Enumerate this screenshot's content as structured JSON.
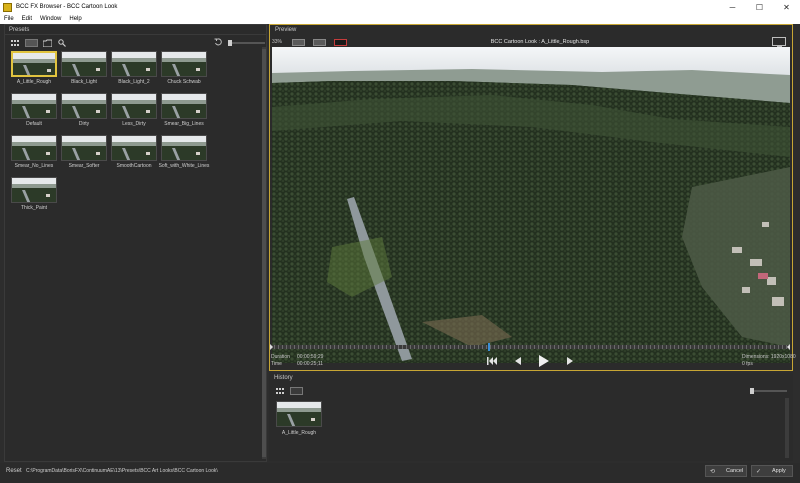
{
  "window": {
    "title": "BCC FX Browser - BCC Cartoon Look",
    "minimize": "─",
    "maximize": "☐",
    "close": "✕"
  },
  "menu": [
    "File",
    "Edit",
    "Window",
    "Help"
  ],
  "presets_panel": {
    "header": "Presets",
    "items": [
      {
        "label": "A_Little_Rough",
        "selected": true
      },
      {
        "label": "Black_Light"
      },
      {
        "label": "Black_Light_2"
      },
      {
        "label": "Chuck Schwab"
      },
      {
        "label": "Default"
      },
      {
        "label": "Dirty"
      },
      {
        "label": "Less_Dirty"
      },
      {
        "label": "Smear_Big_Lines"
      },
      {
        "label": "Smear_No_Lines"
      },
      {
        "label": "Smear_Softer"
      },
      {
        "label": "SmoothCartoon"
      },
      {
        "label": "Soft_with_White_Lines"
      },
      {
        "label": "Thick_Paint"
      }
    ]
  },
  "preview_panel": {
    "header": "Preview",
    "zoom": "33%",
    "clip_title": "BCC Cartoon Look : A_Little_Rough.bsp",
    "duration_label": "Duration",
    "duration_value": "00:00:59;29",
    "time_label": "Time",
    "time_value": "00:00:25;11",
    "dimensions": "Dimensions: 1920x1080",
    "fps": "0 fps",
    "playhead_fraction": 0.42
  },
  "history_panel": {
    "header": "History",
    "items": [
      {
        "label": "A_Little_Rough"
      }
    ]
  },
  "statusbar": {
    "reset": "Reset",
    "path": "C:\\ProgramData\\BorisFX\\ContinuumAE\\13\\Presets\\BCC Art Looks\\BCC Cartoon Look\\",
    "cancel": "Cancel",
    "apply": "Apply"
  },
  "colors": {
    "accent": "#e1c43f",
    "panel": "#2b2b2b",
    "playhead": "#3b8fd6"
  },
  "icons": {
    "grid": "grid-view-icon",
    "folder": "folder-icon",
    "search": "search-icon",
    "reset": "reset-icon",
    "monitor": "monitor-icon",
    "skip_back": "skip-to-start-icon",
    "prev": "previous-frame-icon",
    "play": "play-icon",
    "next": "next-frame-icon"
  }
}
